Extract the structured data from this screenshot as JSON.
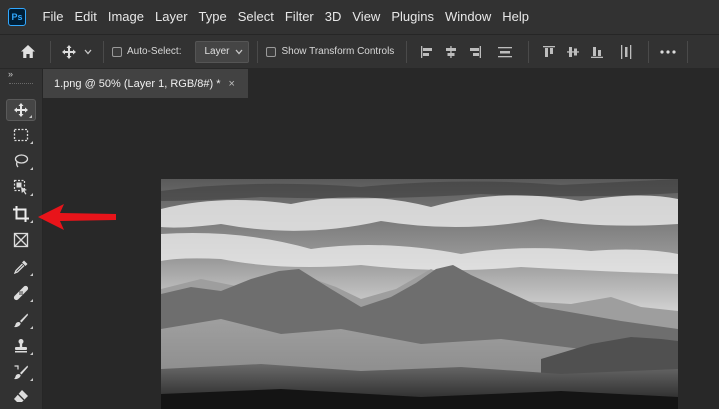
{
  "app": {
    "logo_text": "Ps"
  },
  "menu": [
    "File",
    "Edit",
    "Image",
    "Layer",
    "Type",
    "Select",
    "Filter",
    "3D",
    "View",
    "Plugins",
    "Window",
    "Help"
  ],
  "options_bar": {
    "auto_select_label": "Auto-Select:",
    "auto_select_value": "Layer",
    "show_transform_label": "Show Transform Controls"
  },
  "document_tab": {
    "title": "1.png @ 50% (Layer 1, RGB/8#) *",
    "close_glyph": "×"
  },
  "toolbar": {
    "collapse_glyph": "»",
    "tools": [
      "move-tool",
      "marquee-tool",
      "lasso-tool",
      "object-selection-tool",
      "crop-tool",
      "frame-tool",
      "eyedropper-tool",
      "healing-brush-tool",
      "brush-tool",
      "clone-stamp-tool",
      "history-brush-tool",
      "eraser-tool"
    ]
  },
  "colors": {
    "annotation_arrow": "#e8141a",
    "ps_brand": "#31a8ff",
    "panel": "#323232",
    "canvas_bg": "#282828"
  }
}
